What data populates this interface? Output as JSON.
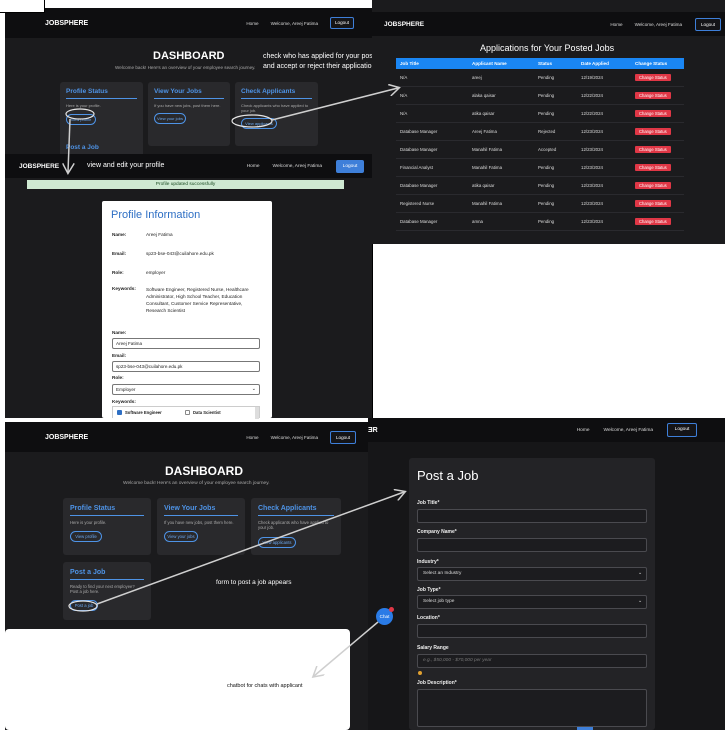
{
  "app": {
    "brand": "JOBSPHERE",
    "home": "Home",
    "welcome": "Welcome, Areej Fatima",
    "logout": "Logout"
  },
  "dashboard": {
    "title": "DASHBOARD",
    "subtitle": "Welcome back! Here's an overview of your employee search journey.",
    "cards": [
      {
        "title": "Profile Status",
        "text": "Here is your profile.",
        "button": "View profile"
      },
      {
        "title": "View Your Jobs",
        "text": "If you have new jobs, post them here.",
        "button": "View your jobs"
      },
      {
        "title": "Check Applicants",
        "text": "Check applicants who have applied to your job.",
        "button": "View applicants"
      },
      {
        "title": "Post a Job",
        "text": "Ready to find your next employee? Post a job here.",
        "button": "Post a job"
      }
    ]
  },
  "annotations": {
    "check": "check who has applied for your posted jobs\nand accept or reject their application",
    "profile": "view and edit your profile",
    "form": "form to post a job appears",
    "chatbot": "chatbot for chats with applicant"
  },
  "applications": {
    "title": "Applications for Your Posted Jobs",
    "columns": [
      "Job Title",
      "Applicant Name",
      "Status",
      "Date Applied",
      "Change Status"
    ],
    "rows": [
      [
        "N/A",
        "areej",
        "Pending",
        "12/19/2024",
        "Change Status"
      ],
      [
        "N/A",
        "alaka qaisar",
        "Pending",
        "12/22/2024",
        "Change Status"
      ],
      [
        "N/A",
        "atika qaisar",
        "Pending",
        "12/22/2024",
        "Change Status"
      ],
      [
        "Database Manager",
        "Areej Fatima",
        "Rejected",
        "12/23/2024",
        "Change Status"
      ],
      [
        "Database Manager",
        "Manahil Fatima",
        "Accepted",
        "12/23/2024",
        "Change Status"
      ],
      [
        "Financial Analyst",
        "Manahil Fatima",
        "Pending",
        "12/23/2024",
        "Change Status"
      ],
      [
        "Database Manager",
        "atika qaisar",
        "Pending",
        "12/23/2024",
        "Change Status"
      ],
      [
        "Registered Nurse",
        "Manahil Fatima",
        "Pending",
        "12/23/2024",
        "Change Status"
      ],
      [
        "Database Manager",
        "amna",
        "Pending",
        "12/23/2024",
        "Change Status"
      ]
    ]
  },
  "profile": {
    "success": "Profile updated successfully",
    "title": "Profile Information",
    "name_label": "Name:",
    "name": "Areej Fatima",
    "email_label": "Email:",
    "email": "sp23-bse-043@cuilahore.edu.pk",
    "role_label": "Role:",
    "role": "employer",
    "keywords_label": "Keywords:",
    "keywords": "Software Engineer, Registered Nurse, Healthcare Administrator, High School Teacher, Education Consultant, Customer Service Representative, Research Scientist",
    "form": {
      "name_label": "Name:",
      "name_value": "Areej Fatima",
      "email_label": "Email:",
      "email_value": "sp23-bse-043@cuilahore.edu.pk",
      "role_label": "Role:",
      "role_value": "Employer",
      "keywords_label": "Keywords:",
      "kw1": "Software Engineer",
      "kw2": "Data Scientist"
    }
  },
  "post_job": {
    "title": "Post a Job",
    "job_title": "Job Title*",
    "company": "Company Name*",
    "industry": "Industry*",
    "industry_placeholder": "Select an Industry",
    "job_type": "Job Type*",
    "job_type_placeholder": "Select job type",
    "location": "Location*",
    "salary": "Salary Range",
    "salary_placeholder": "e.g., $50,000 - $70,000 per year",
    "description": "Job Description*"
  },
  "chat": {
    "label": "Chat"
  },
  "colors": {
    "accent": "#3e7fd9",
    "danger": "#e03746",
    "table_header": "#1a86f3"
  }
}
